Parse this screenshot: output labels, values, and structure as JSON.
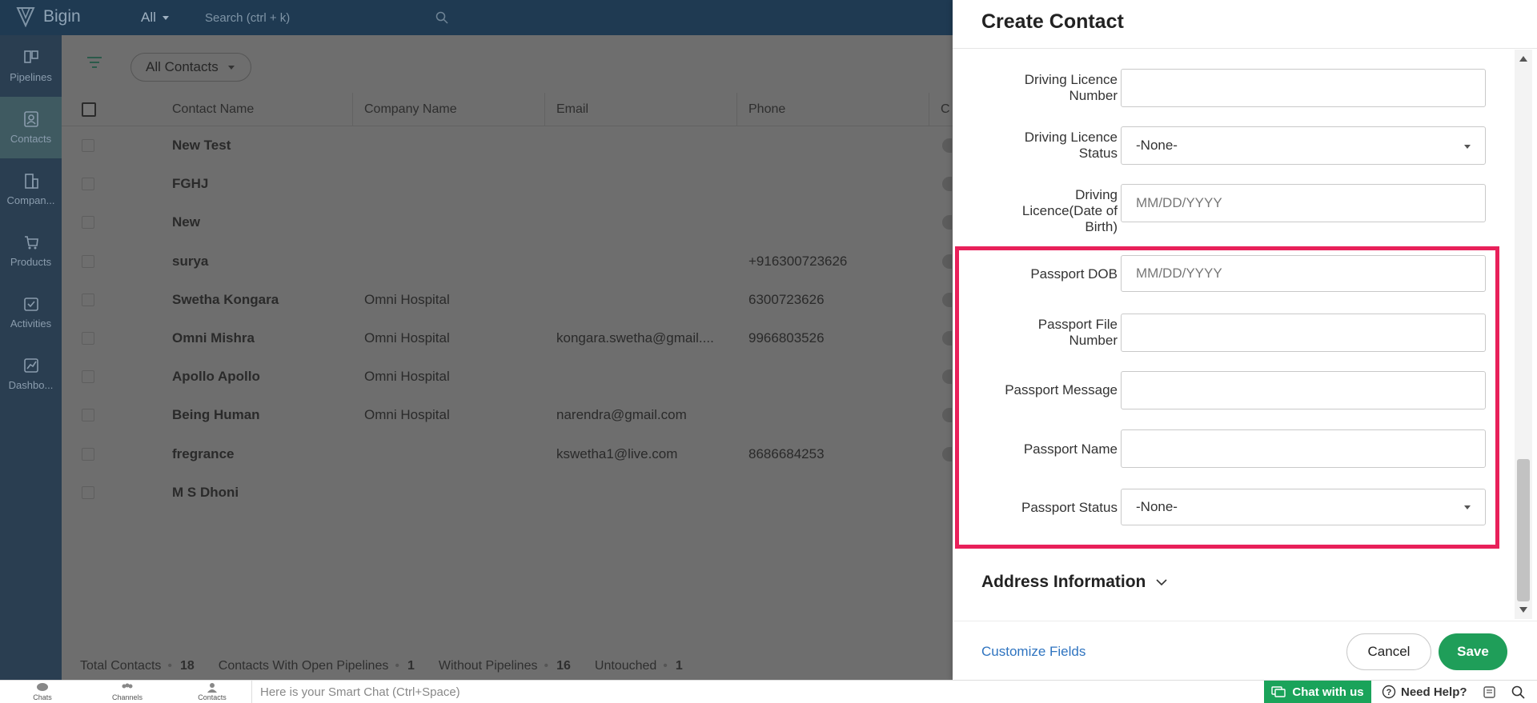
{
  "app": {
    "name": "Bigin",
    "scope": "All",
    "search_placeholder": "Search (ctrl + k)"
  },
  "sidebar": {
    "items": [
      {
        "label": "Pipelines",
        "icon": "pipelines-icon"
      },
      {
        "label": "Contacts",
        "icon": "contacts-icon",
        "active": true
      },
      {
        "label": "Compan...",
        "icon": "companies-icon"
      },
      {
        "label": "Products",
        "icon": "products-icon"
      },
      {
        "label": "Activities",
        "icon": "activities-icon"
      },
      {
        "label": "Dashbo...",
        "icon": "dashboards-icon"
      }
    ]
  },
  "list": {
    "view": "All Contacts",
    "columns": [
      "Contact Name",
      "Company Name",
      "Email",
      "Phone",
      "C"
    ],
    "rows": [
      {
        "name": "New Test",
        "company": "",
        "email": "",
        "phone": ""
      },
      {
        "name": "FGHJ",
        "company": "",
        "email": "",
        "phone": ""
      },
      {
        "name": "New",
        "company": "",
        "email": "",
        "phone": ""
      },
      {
        "name": "surya",
        "company": "",
        "email": "",
        "phone": "+916300723626"
      },
      {
        "name": "Swetha Kongara",
        "company": "Omni Hospital",
        "email": "",
        "phone": "6300723626"
      },
      {
        "name": "Omni Mishra",
        "company": "Omni Hospital",
        "email": "kongara.swetha@gmail....",
        "phone": "9966803526"
      },
      {
        "name": "Apollo Apollo",
        "company": "Omni Hospital",
        "email": "",
        "phone": ""
      },
      {
        "name": "Being Human",
        "company": "Omni Hospital",
        "email": "narendra@gmail.com",
        "phone": ""
      },
      {
        "name": "fregrance",
        "company": "",
        "email": "kswetha1@live.com",
        "phone": "8686684253"
      },
      {
        "name": "M S Dhoni",
        "company": "",
        "email": "",
        "phone": ""
      }
    ],
    "summary": {
      "total_label": "Total Contacts",
      "total_value": "18",
      "open_label": "Contacts With Open Pipelines",
      "open_value": "1",
      "without_label": "Without Pipelines",
      "without_value": "16",
      "untouched_label": "Untouched",
      "untouched_value": "1",
      "separator": "•"
    }
  },
  "panel": {
    "title": "Create Contact",
    "fields": {
      "dl_number": {
        "label_line1": "Driving Licence",
        "label_line2": "Number",
        "value": ""
      },
      "dl_status": {
        "label_line1": "Driving Licence",
        "label_line2": "Status",
        "value": "-None-"
      },
      "dl_dob": {
        "label_line1": "Driving",
        "label_line2": "Licence(Date of",
        "label_line3": "Birth)",
        "placeholder": "MM/DD/YYYY"
      },
      "passport_dob": {
        "label": "Passport DOB",
        "placeholder": "MM/DD/YYYY"
      },
      "passport_file_number": {
        "label_line1": "Passport File",
        "label_line2": "Number",
        "value": ""
      },
      "passport_message": {
        "label": "Passport Message",
        "value": ""
      },
      "passport_name": {
        "label": "Passport Name",
        "value": ""
      },
      "passport_status": {
        "label": "Passport Status",
        "value": "-None-"
      }
    },
    "address_section": "Address Information",
    "customize": "Customize Fields",
    "cancel": "Cancel",
    "save": "Save",
    "highlight_color": "#e8205a"
  },
  "bottombar": {
    "items": [
      {
        "label": "Chats",
        "icon": "chats-icon"
      },
      {
        "label": "Channels",
        "icon": "channels-icon"
      },
      {
        "label": "Contacts",
        "icon": "contacts-icon"
      }
    ],
    "smartchat_placeholder": "Here is your Smart Chat (Ctrl+Space)",
    "chat_with_us": "Chat with us",
    "need_help": "Need Help?"
  },
  "colors": {
    "accent_green": "#1f9e59",
    "link_blue": "#2f74c0",
    "topbar": "#1f3a52",
    "sidebar": "#2a3e51"
  }
}
